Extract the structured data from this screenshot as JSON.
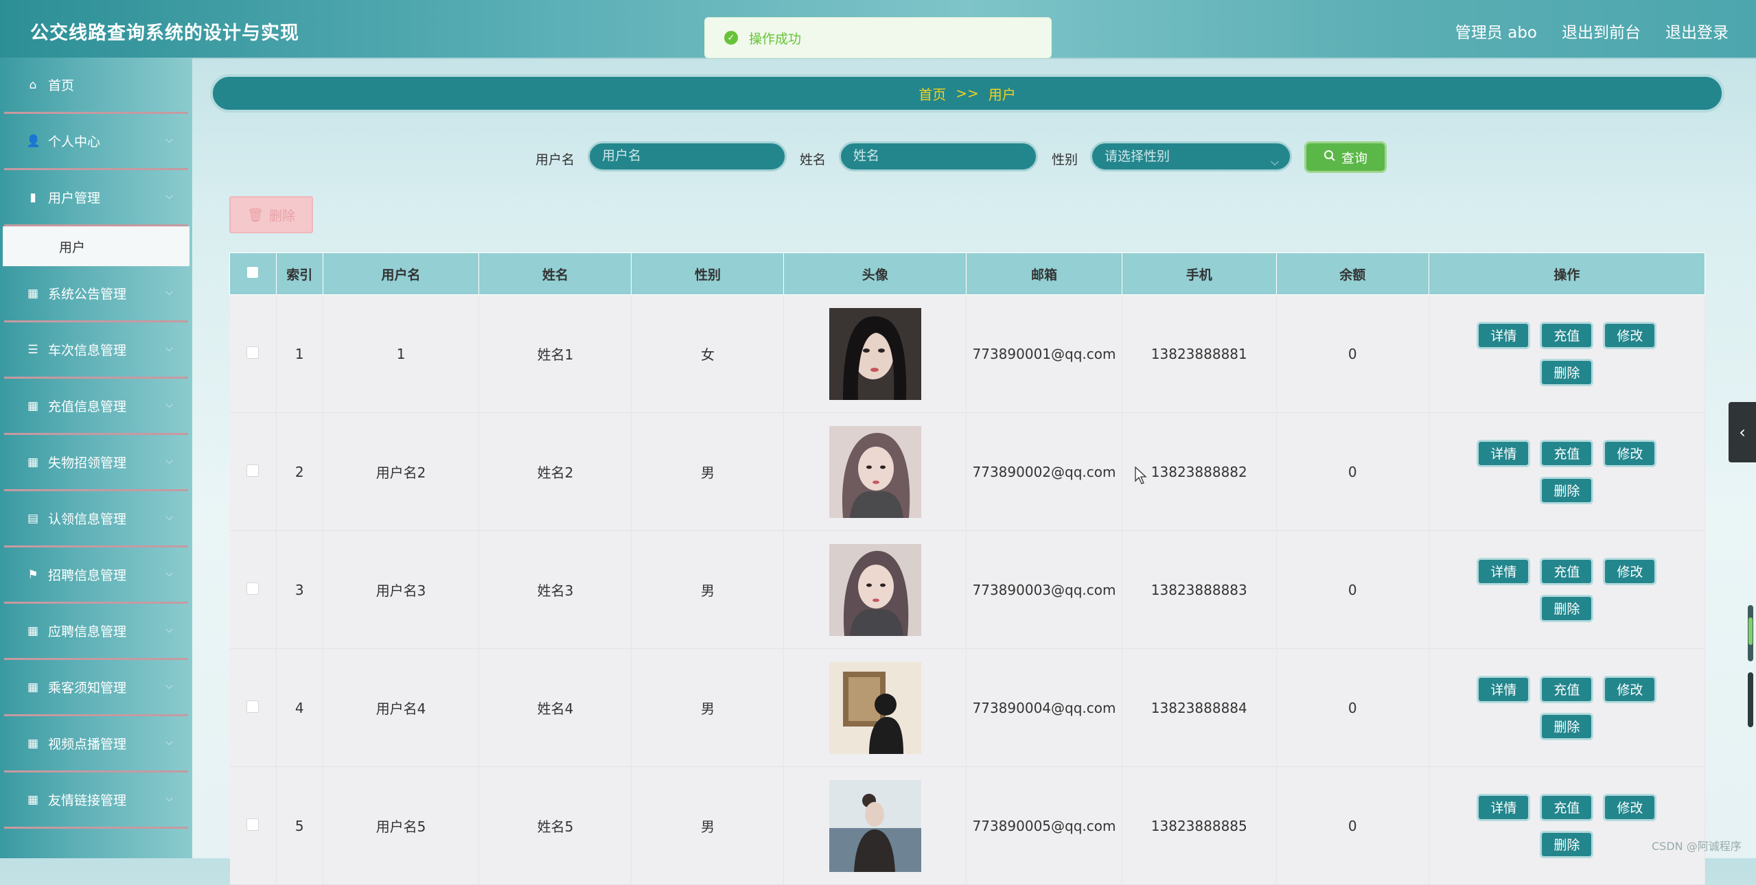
{
  "header": {
    "title": "公交线路查询系统的设计与实现",
    "admin_label": "管理员 abo",
    "to_front": "退出到前台",
    "logout": "退出登录"
  },
  "toast": {
    "message": "操作成功"
  },
  "sidebar": {
    "items": [
      {
        "label": "首页",
        "icon": "home-icon"
      },
      {
        "label": "个人中心",
        "icon": "user-icon"
      },
      {
        "label": "用户管理",
        "icon": "bar-chart-icon"
      },
      {
        "label": "系统公告管理",
        "icon": "grid-icon"
      },
      {
        "label": "车次信息管理",
        "icon": "list-icon"
      },
      {
        "label": "充值信息管理",
        "icon": "grid-icon"
      },
      {
        "label": "失物招领管理",
        "icon": "grid-icon"
      },
      {
        "label": "认领信息管理",
        "icon": "clipboard-icon"
      },
      {
        "label": "招聘信息管理",
        "icon": "flag-icon"
      },
      {
        "label": "应聘信息管理",
        "icon": "grid-icon"
      },
      {
        "label": "乘客须知管理",
        "icon": "grid-icon"
      },
      {
        "label": "视频点播管理",
        "icon": "grid-icon"
      },
      {
        "label": "友情链接管理",
        "icon": "grid-icon"
      }
    ],
    "submenu": {
      "label": "用户"
    }
  },
  "breadcrumb": {
    "home": "首页",
    "sep": ">>",
    "current": "用户"
  },
  "search": {
    "username_label": "用户名",
    "username_placeholder": "用户名",
    "name_label": "姓名",
    "name_placeholder": "姓名",
    "gender_label": "性别",
    "gender_placeholder": "请选择性别",
    "query_button": "查询"
  },
  "batch_delete": "删除",
  "table": {
    "headers": [
      "",
      "索引",
      "用户名",
      "姓名",
      "性别",
      "头像",
      "邮箱",
      "手机",
      "余额",
      "操作"
    ],
    "rows": [
      {
        "index": "1",
        "username": "1",
        "name": "姓名1",
        "gender": "女",
        "email": "773890001@qq.com",
        "phone": "13823888881",
        "balance": "0"
      },
      {
        "index": "2",
        "username": "用户名2",
        "name": "姓名2",
        "gender": "男",
        "email": "773890002@qq.com",
        "phone": "13823888882",
        "balance": "0"
      },
      {
        "index": "3",
        "username": "用户名3",
        "name": "姓名3",
        "gender": "男",
        "email": "773890003@qq.com",
        "phone": "13823888883",
        "balance": "0"
      },
      {
        "index": "4",
        "username": "用户名4",
        "name": "姓名4",
        "gender": "男",
        "email": "773890004@qq.com",
        "phone": "13823888884",
        "balance": "0"
      },
      {
        "index": "5",
        "username": "用户名5",
        "name": "姓名5",
        "gender": "男",
        "email": "773890005@qq.com",
        "phone": "13823888885",
        "balance": "0"
      }
    ],
    "actions": {
      "detail": "详情",
      "recharge": "充值",
      "edit": "修改",
      "delete": "删除"
    }
  },
  "watermark": "CSDN @阿诚程序",
  "colors": {
    "primary": "#24868d",
    "accent_yellow": "#f3d21b",
    "success": "#67c23a",
    "query": "#5bb748"
  }
}
